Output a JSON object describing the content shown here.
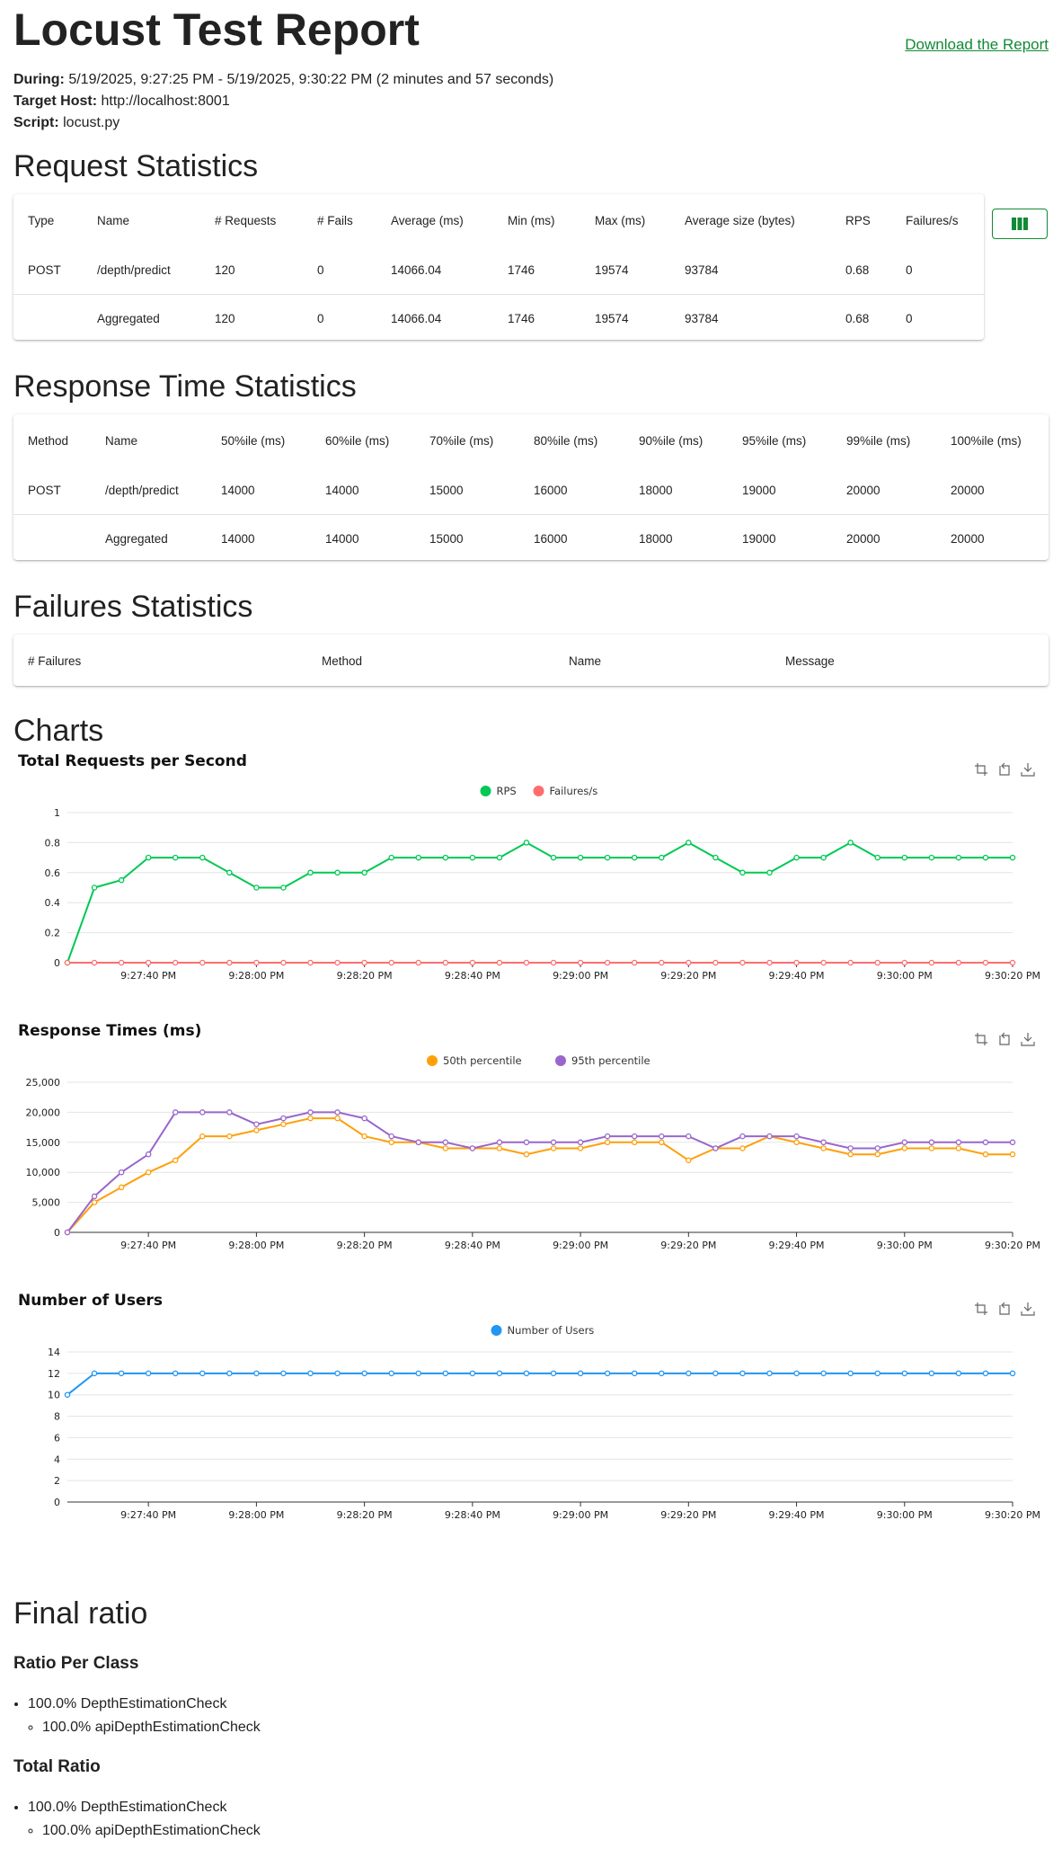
{
  "header": {
    "title": "Locust Test Report",
    "download_label": "Download the Report",
    "during_label": "During:",
    "during_value": "5/19/2025, 9:27:25 PM - 5/19/2025, 9:30:22 PM (2 minutes and 57 seconds)",
    "host_label": "Target Host:",
    "host_value": "http://localhost:8001",
    "script_label": "Script:",
    "script_value": "locust.py"
  },
  "request_stats": {
    "title": "Request Statistics",
    "columns": [
      "Type",
      "Name",
      "# Requests",
      "# Fails",
      "Average (ms)",
      "Min (ms)",
      "Max (ms)",
      "Average size (bytes)",
      "RPS",
      "Failures/s"
    ],
    "rows": [
      [
        "POST",
        "/depth/predict",
        "120",
        "0",
        "14066.04",
        "1746",
        "19574",
        "93784",
        "0.68",
        "0"
      ],
      [
        "",
        "Aggregated",
        "120",
        "0",
        "14066.04",
        "1746",
        "19574",
        "93784",
        "0.68",
        "0"
      ]
    ]
  },
  "response_stats": {
    "title": "Response Time Statistics",
    "columns": [
      "Method",
      "Name",
      "50%ile (ms)",
      "60%ile (ms)",
      "70%ile (ms)",
      "80%ile (ms)",
      "90%ile (ms)",
      "95%ile (ms)",
      "99%ile (ms)",
      "100%ile (ms)"
    ],
    "rows": [
      [
        "POST",
        "/depth/predict",
        "14000",
        "14000",
        "15000",
        "16000",
        "18000",
        "19000",
        "20000",
        "20000"
      ],
      [
        "",
        "Aggregated",
        "14000",
        "14000",
        "15000",
        "16000",
        "18000",
        "19000",
        "20000",
        "20000"
      ]
    ]
  },
  "failure_stats": {
    "title": "Failures Statistics",
    "columns": [
      "# Failures",
      "Method",
      "Name",
      "Message"
    ]
  },
  "charts_title": "Charts",
  "colors": {
    "accent": "#118a34",
    "rps": "#00c853",
    "fail": "#ff6d6d",
    "p50": "#ff9f0a",
    "p95": "#9966cc",
    "users": "#2196f3"
  },
  "chart_data": [
    {
      "type": "line",
      "title": "Total Requests per Second",
      "x_ticks": [
        "9:27:40 PM",
        "9:28:00 PM",
        "9:28:20 PM",
        "9:28:40 PM",
        "9:29:00 PM",
        "9:29:20 PM",
        "9:29:40 PM",
        "9:30:00 PM",
        "9:30:20 PM"
      ],
      "ylim": [
        0,
        1
      ],
      "y_ticks": [
        "0",
        "0.2",
        "0.4",
        "0.6",
        "0.8",
        "1"
      ],
      "series": [
        {
          "name": "RPS",
          "values": [
            0,
            0.5,
            0.55,
            0.7,
            0.7,
            0.7,
            0.6,
            0.5,
            0.5,
            0.6,
            0.6,
            0.6,
            0.7,
            0.7,
            0.7,
            0.7,
            0.7,
            0.8,
            0.7,
            0.7,
            0.7,
            0.7,
            0.7,
            0.8,
            0.7,
            0.6,
            0.6,
            0.7,
            0.7,
            0.8,
            0.7,
            0.7,
            0.7,
            0.7,
            0.7,
            0.7
          ]
        },
        {
          "name": "Failures/s",
          "values": [
            0,
            0,
            0,
            0,
            0,
            0,
            0,
            0,
            0,
            0,
            0,
            0,
            0,
            0,
            0,
            0,
            0,
            0,
            0,
            0,
            0,
            0,
            0,
            0,
            0,
            0,
            0,
            0,
            0,
            0,
            0,
            0,
            0,
            0,
            0,
            0
          ]
        }
      ]
    },
    {
      "type": "line",
      "title": "Response Times (ms)",
      "x_ticks": [
        "9:27:40 PM",
        "9:28:00 PM",
        "9:28:20 PM",
        "9:28:40 PM",
        "9:29:00 PM",
        "9:29:20 PM",
        "9:29:40 PM",
        "9:30:00 PM",
        "9:30:20 PM"
      ],
      "ylim": [
        0,
        25000
      ],
      "y_ticks": [
        "0",
        "5,000",
        "10,000",
        "15,000",
        "20,000",
        "25,000"
      ],
      "series": [
        {
          "name": "50th percentile",
          "values": [
            0,
            5000,
            7500,
            10000,
            12000,
            16000,
            16000,
            17000,
            18000,
            19000,
            19000,
            16000,
            15000,
            15000,
            14000,
            14000,
            14000,
            13000,
            14000,
            14000,
            15000,
            15000,
            15000,
            12000,
            14000,
            14000,
            16000,
            15000,
            14000,
            13000,
            13000,
            14000,
            14000,
            14000,
            13000,
            13000
          ]
        },
        {
          "name": "95th percentile",
          "values": [
            0,
            6000,
            10000,
            13000,
            20000,
            20000,
            20000,
            18000,
            19000,
            20000,
            20000,
            19000,
            16000,
            15000,
            15000,
            14000,
            15000,
            15000,
            15000,
            15000,
            16000,
            16000,
            16000,
            16000,
            14000,
            16000,
            16000,
            16000,
            15000,
            14000,
            14000,
            15000,
            15000,
            15000,
            15000,
            15000
          ]
        }
      ]
    },
    {
      "type": "line",
      "title": "Number of Users",
      "x_ticks": [
        "9:27:40 PM",
        "9:28:00 PM",
        "9:28:20 PM",
        "9:28:40 PM",
        "9:29:00 PM",
        "9:29:20 PM",
        "9:29:40 PM",
        "9:30:00 PM",
        "9:30:20 PM"
      ],
      "ylim": [
        0,
        14
      ],
      "y_ticks": [
        "0",
        "2",
        "4",
        "6",
        "8",
        "10",
        "12",
        "14"
      ],
      "series": [
        {
          "name": "Number of Users",
          "values": [
            10,
            12,
            12,
            12,
            12,
            12,
            12,
            12,
            12,
            12,
            12,
            12,
            12,
            12,
            12,
            12,
            12,
            12,
            12,
            12,
            12,
            12,
            12,
            12,
            12,
            12,
            12,
            12,
            12,
            12,
            12,
            12,
            12,
            12,
            12,
            12
          ]
        }
      ]
    }
  ],
  "ratio": {
    "title": "Final ratio",
    "per_class_title": "Ratio Per Class",
    "per_class": {
      "item": "100.0% DepthEstimationCheck",
      "sub": "100.0% apiDepthEstimationCheck"
    },
    "total_title": "Total Ratio",
    "total": {
      "item": "100.0% DepthEstimationCheck",
      "sub": "100.0% apiDepthEstimationCheck"
    }
  }
}
